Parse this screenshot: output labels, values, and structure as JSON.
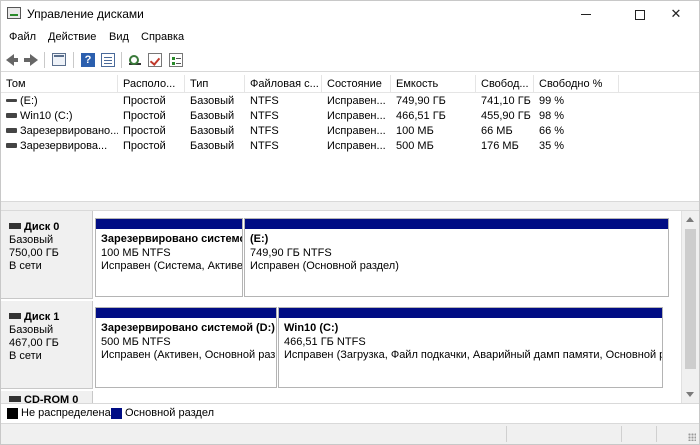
{
  "window": {
    "title": "Управление дисками",
    "controls": [
      "minimize",
      "maximize",
      "close"
    ]
  },
  "menu": [
    {
      "label": "Файл"
    },
    {
      "label": "Действие"
    },
    {
      "label": "Вид"
    },
    {
      "label": "Справка"
    }
  ],
  "toolbar": {
    "icons": [
      "back-icon",
      "forward-icon",
      "console-tree-icon",
      "help-icon",
      "list-view-icon",
      "connect-disk-icon",
      "check-icon",
      "properties-icon"
    ]
  },
  "volumes": {
    "columns": [
      "Том",
      "Располо...",
      "Тип",
      "Файловая с...",
      "Состояние",
      "Емкость",
      "Свобод...",
      "Свободно %"
    ],
    "rows": [
      {
        "name": "(E:)",
        "layout": "Простой",
        "type": "Базовый",
        "fs": "NTFS",
        "status": "Исправен...",
        "capacity": "749,90 ГБ",
        "free": "741,10 ГБ",
        "free_pct": "99 %"
      },
      {
        "name": "Win10 (C:)",
        "layout": "Простой",
        "type": "Базовый",
        "fs": "NTFS",
        "status": "Исправен...",
        "capacity": "466,51 ГБ",
        "free": "455,90 ГБ",
        "free_pct": "98 %"
      },
      {
        "name": "Зарезервировано...",
        "layout": "Простой",
        "type": "Базовый",
        "fs": "NTFS",
        "status": "Исправен...",
        "capacity": "100 МБ",
        "free": "66 МБ",
        "free_pct": "66 %"
      },
      {
        "name": "Зарезервирова...",
        "layout": "Простой",
        "type": "Базовый",
        "fs": "NTFS",
        "status": "Исправен...",
        "capacity": "500 МБ",
        "free": "176 МБ",
        "free_pct": "35 %"
      }
    ]
  },
  "disks": [
    {
      "name": "Диск 0",
      "type": "Базовый",
      "size": "750,00 ГБ",
      "state": "В сети",
      "partitions": [
        {
          "name": "Зарезервировано системой",
          "size": "100 МБ NTFS",
          "status": "Исправен (Система, Активе"
        },
        {
          "name": "(E:)",
          "size": "749,90 ГБ NTFS",
          "status": "Исправен (Основной раздел)"
        }
      ]
    },
    {
      "name": "Диск 1",
      "type": "Базовый",
      "size": "467,00 ГБ",
      "state": "В сети",
      "partitions": [
        {
          "name": "Зарезервировано системой  (D:)",
          "size": "500 МБ NTFS",
          "status": "Исправен (Активен, Основной раз"
        },
        {
          "name": "Win10  (C:)",
          "size": "466,51 ГБ NTFS",
          "status": "Исправен (Загрузка, Файл подкачки, Аварийный дамп памяти, Основной р"
        }
      ]
    },
    {
      "name": "CD-ROM 0"
    }
  ],
  "legend": [
    {
      "label": "Не распределена",
      "color": "#000000"
    },
    {
      "label": "Основной раздел",
      "color": "#000c84"
    }
  ],
  "colors": {
    "partition_bar": "#000c84",
    "disk_label_bg": "#f0f0f0"
  }
}
